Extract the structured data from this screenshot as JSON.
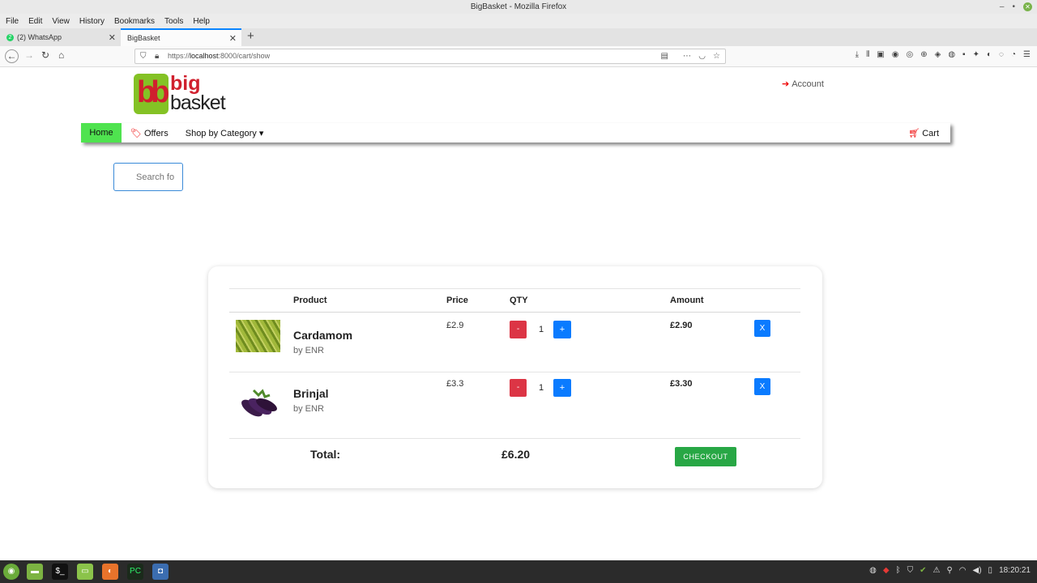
{
  "window": {
    "title": "BigBasket - Mozilla Firefox",
    "controls": [
      "–",
      "•",
      "✕"
    ]
  },
  "menu": [
    "File",
    "Edit",
    "View",
    "History",
    "Bookmarks",
    "Tools",
    "Help"
  ],
  "tabs": [
    {
      "label": "(2) WhatsApp",
      "badge": "2"
    },
    {
      "label": "BigBasket"
    }
  ],
  "url": {
    "prefix": "https://",
    "host": "localhost",
    "rest": ":8000/cart/show"
  },
  "icons": {
    "back": "back-arrow-icon",
    "forward": "forward-arrow-icon",
    "reload": "reload-icon",
    "home": "home-icon",
    "account": "sign-in-icon",
    "offers": "tag-icon",
    "cart": "cart-icon"
  },
  "logo": {
    "bb": "bb",
    "big": "big",
    "basket": "basket"
  },
  "header": {
    "account": "Account"
  },
  "nav": {
    "home": "Home",
    "offers": "Offers",
    "category": "Shop by Category",
    "cart": "Cart"
  },
  "search": {
    "placeholder": "Search fo"
  },
  "cart": {
    "columns": {
      "product": "Product",
      "price": "Price",
      "qty": "QTY",
      "amount": "Amount"
    },
    "items": [
      {
        "name": "Cardamom",
        "by": "by ENR",
        "price": "£2.9",
        "minus": "-",
        "qty": "1",
        "plus": "+",
        "amount": "£2.90",
        "remove": "X"
      },
      {
        "name": "Brinjal",
        "by": "by ENR",
        "price": "£3.3",
        "minus": "-",
        "qty": "1",
        "plus": "+",
        "amount": "£3.30",
        "remove": "X"
      }
    ],
    "total_label": "Total:",
    "total_value": "£6.20",
    "checkout": "CHECKOUT"
  },
  "taskbar": {
    "clock": "18:20:21"
  },
  "colors": {
    "home_nav": "#4fe34f",
    "minus_btn": "#dc3545",
    "plus_btn": "#0a7bff",
    "checkout_btn": "#28a745",
    "accent_red": "#d0202e",
    "logo_green": "#84c225"
  }
}
